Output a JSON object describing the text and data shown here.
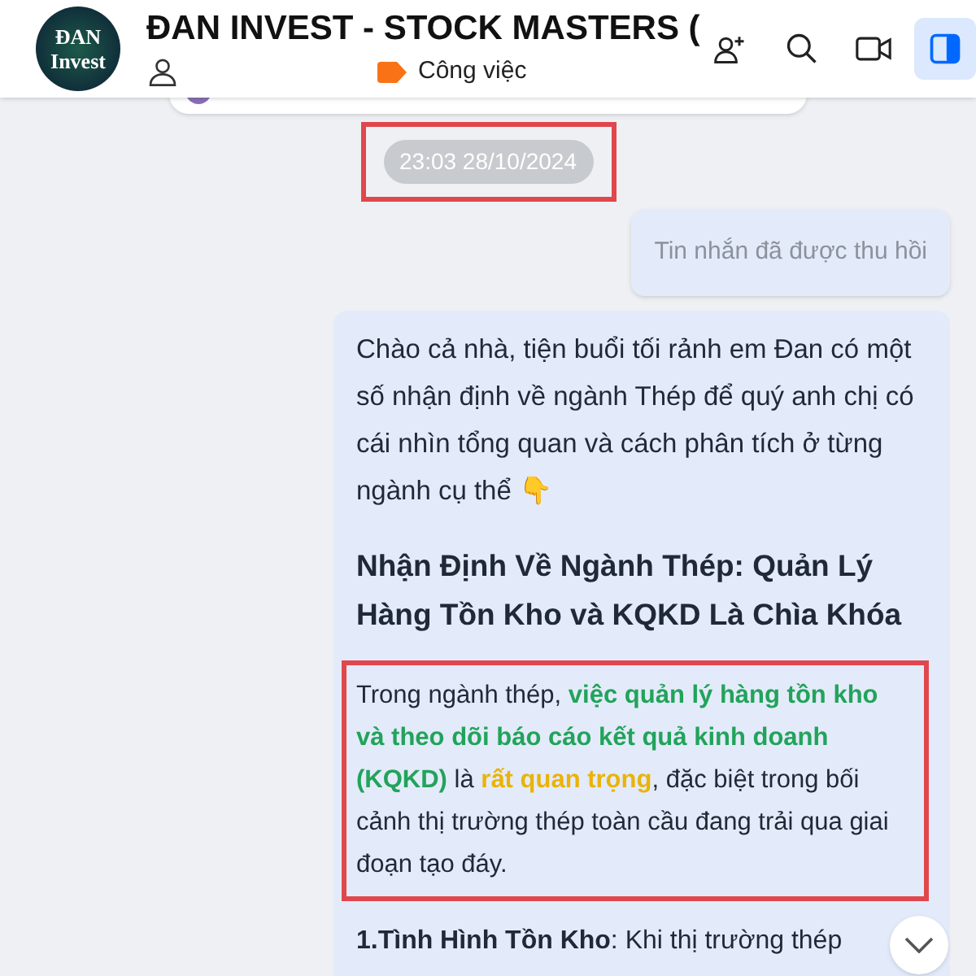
{
  "header": {
    "avatar_text": "ĐAN Invest",
    "title": "ĐAN INVEST - STOCK MASTERS (",
    "tag": {
      "label": "Công việc",
      "color": "#f97316"
    },
    "actions": [
      {
        "kind": "add-member",
        "selected": false
      },
      {
        "kind": "search",
        "selected": false
      },
      {
        "kind": "video",
        "selected": false
      },
      {
        "kind": "panel",
        "selected": true
      }
    ]
  },
  "timestamp": {
    "text": "23:03 28/10/2024",
    "highlighted": true
  },
  "messages": [
    {
      "kind": "recalled",
      "text": "Tin nhắn đã được thu hồi"
    },
    {
      "kind": "post",
      "intro": "Chào cả nhà, tiện buổi tối rảnh em Đan có một số nhận định về ngành Thép để quý anh chị có cái nhìn tổng quan và cách phân tích ở từng ngành cụ thể 👇",
      "heading": "Nhận Định Về Ngành Thép: Quản Lý Hàng Tồn Kho và KQKD Là Chìa Khóa",
      "highlighted": true,
      "segments": [
        {
          "text": "Trong ngành thép, ",
          "color": "#1f2937"
        },
        {
          "text": "việc quản lý hàng tồn kho và theo dõi báo cáo kết quả kinh doanh (KQKD)",
          "color": "#22a35a"
        },
        {
          "text": " là ",
          "color": "#1f2937"
        },
        {
          "text": "rất quan trọng",
          "color": "#eab308"
        },
        {
          "text": ", đặc biệt trong bối cảnh thị trường thép toàn cầu đang trải qua giai đoạn tạo đáy.",
          "color": "#1f2937"
        }
      ],
      "point": "**1.Tình Hình Tồn Kho**: Khi thị trường thép"
    }
  ]
}
